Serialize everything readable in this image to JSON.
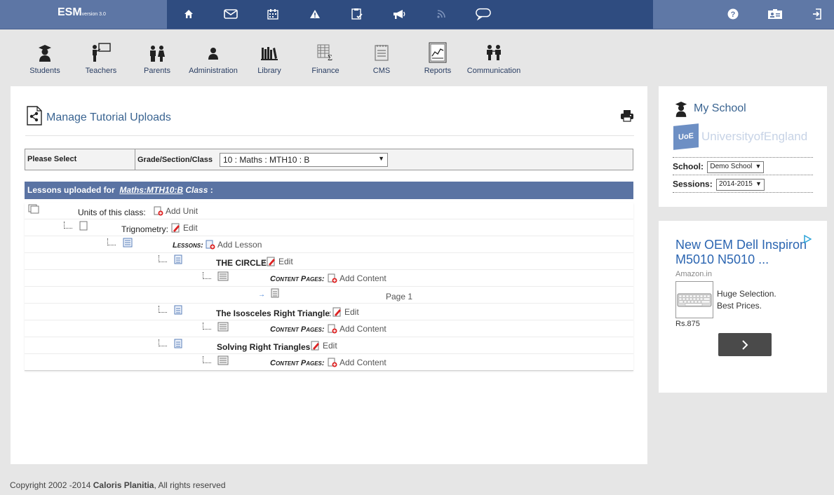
{
  "brand": {
    "name": "ESM",
    "version": "version 3.0"
  },
  "topnav": {
    "icons": [
      "home-icon",
      "mail-icon",
      "calendar-icon",
      "alert-icon",
      "clipboard-check-icon",
      "megaphone-icon",
      "rss-icon",
      "chat-icon"
    ],
    "right_icons": [
      "help-icon",
      "id-card-icon",
      "logout-icon"
    ]
  },
  "modules": [
    {
      "label": "Students",
      "icon": "student-icon"
    },
    {
      "label": "Teachers",
      "icon": "teacher-icon"
    },
    {
      "label": "Parents",
      "icon": "parents-icon"
    },
    {
      "label": "Administration",
      "icon": "administration-icon"
    },
    {
      "label": "Library",
      "icon": "library-icon"
    },
    {
      "label": "Finance",
      "icon": "finance-icon"
    },
    {
      "label": "CMS",
      "icon": "cms-icon"
    },
    {
      "label": "Reports",
      "icon": "reports-icon"
    },
    {
      "label": "Communication",
      "icon": "communication-icon"
    }
  ],
  "page": {
    "title": "Manage Tutorial Uploads"
  },
  "filter": {
    "please_select": "Please Select",
    "grade_label": "Grade/Section/Class",
    "grade_value": "10 : Maths : MTH10 : B"
  },
  "lessons_bar": {
    "prefix": "Lessons uploaded for",
    "class_link": "Maths:MTH10:B",
    "suffix": "Class",
    "colon": ":"
  },
  "tree": {
    "units_label": "Units of this class:",
    "add_unit": "Add Unit",
    "unit_name": "Trignometry:",
    "edit": "Edit",
    "lessons_label": "Lessons:",
    "add_lesson": "Add Lesson",
    "content_pages_label": "Content Pages:",
    "add_content": "Add Content",
    "lesson1": "THE CIRCLE",
    "page1": "Page 1",
    "lesson2": "The Isosceles Right Triangle",
    "lesson3": "Solving Right Triangles",
    "colon": ":"
  },
  "school": {
    "header": "My School",
    "uoe_abbr": "UoE",
    "uoe_name": "UniversityofEngland",
    "school_label": "School:",
    "school_value": "Demo School",
    "sessions_label": "Sessions:",
    "sessions_value": "2014-2015"
  },
  "ad": {
    "title": "New OEM Dell Inspiron M5010 N5010 ...",
    "source": "Amazon.in",
    "text1": "Huge Selection.",
    "text2": "Best Prices.",
    "price": "Rs.875",
    "button_icon": "chevron-right-icon"
  },
  "footer": {
    "copyright": "Copyright 2002 -2014",
    "company": "Caloris Planitia",
    "rights": ", All rights reserved"
  }
}
